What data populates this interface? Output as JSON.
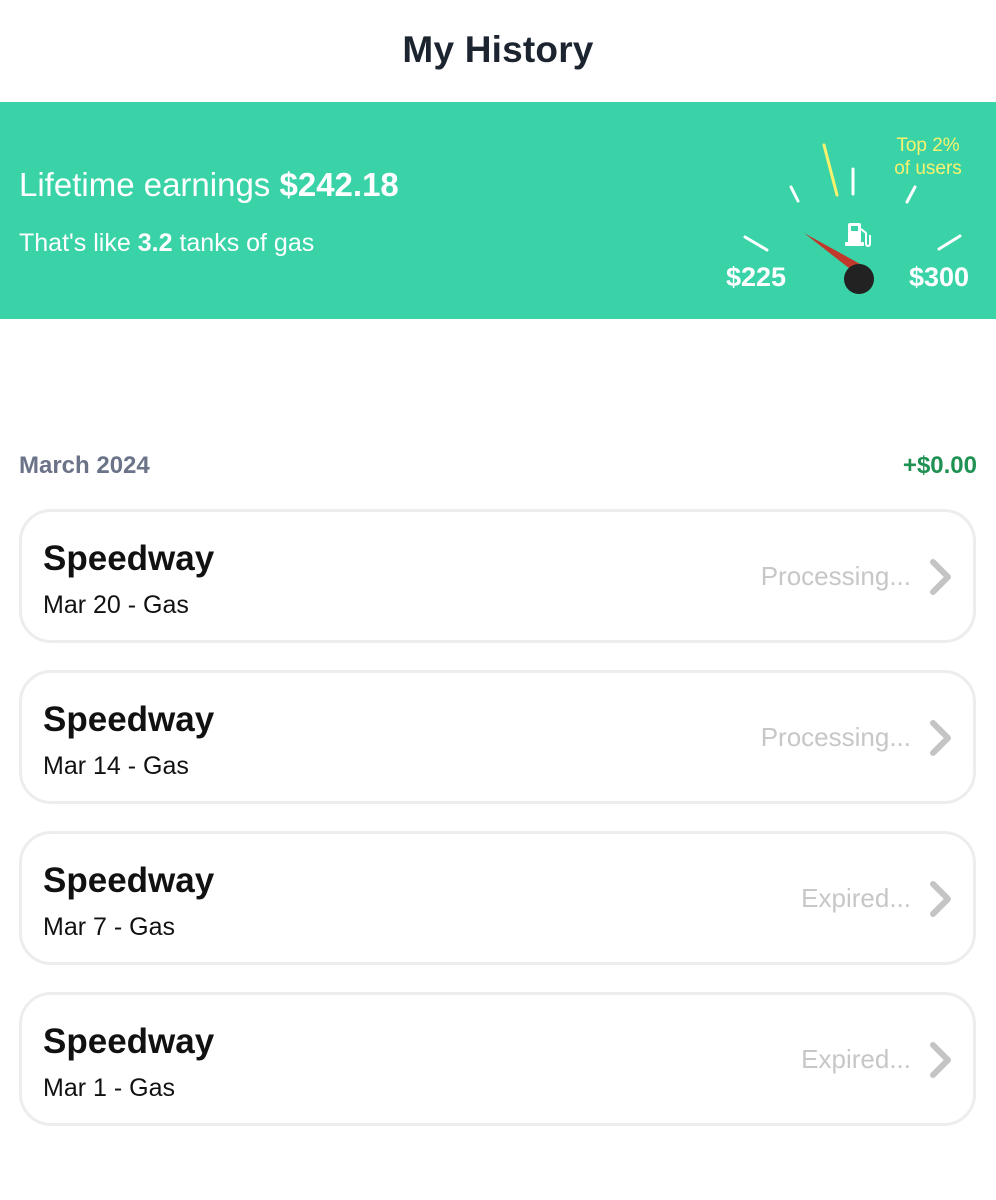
{
  "header": {
    "title": "My History"
  },
  "banner": {
    "earnings_label": "Lifetime earnings",
    "earnings_amount": "$242.18",
    "tanks_prefix": "That's like",
    "tanks_value": "3.2",
    "tanks_suffix": "tanks of gas",
    "gauge": {
      "min_label": "$225",
      "max_label": "$300",
      "top_label_line1": "Top 2%",
      "top_label_line2": "of users",
      "icon": "fuel-pump-icon",
      "needle_color": "#c0392b",
      "marker_color": "#f6f26e"
    },
    "background_color": "#3ad3a8"
  },
  "section": {
    "title": "March 2024",
    "total": "+$0.00",
    "total_color": "#1f9152"
  },
  "transactions": [
    {
      "merchant": "Speedway",
      "detail": "Mar 20 - Gas",
      "status": "Processing..."
    },
    {
      "merchant": "Speedway",
      "detail": "Mar 14 - Gas",
      "status": "Processing..."
    },
    {
      "merchant": "Speedway",
      "detail": "Mar 7 - Gas",
      "status": "Expired..."
    },
    {
      "merchant": "Speedway",
      "detail": "Mar 1 - Gas",
      "status": "Expired..."
    }
  ]
}
